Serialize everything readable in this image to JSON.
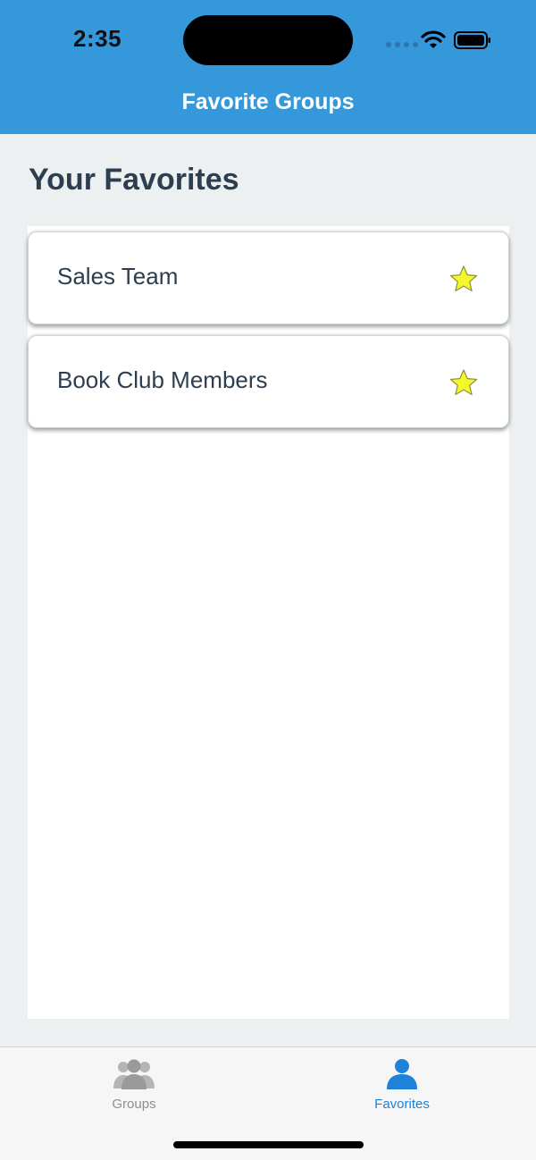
{
  "status_bar": {
    "time": "2:35"
  },
  "header": {
    "title": "Favorite Groups",
    "background_color": "#3498db"
  },
  "main": {
    "section_title": "Your Favorites",
    "favorites": [
      {
        "label": "Sales Team",
        "icon": "star-icon",
        "starred": true
      },
      {
        "label": "Book Club Members",
        "icon": "star-icon",
        "starred": true
      }
    ],
    "star_color": "#f4f72a"
  },
  "tab_bar": {
    "tabs": [
      {
        "label": "Groups",
        "icon": "group-icon",
        "active": false
      },
      {
        "label": "Favorites",
        "icon": "person-icon",
        "active": true
      }
    ],
    "active_color": "#1f82d9",
    "inactive_color": "#8e8e93"
  }
}
